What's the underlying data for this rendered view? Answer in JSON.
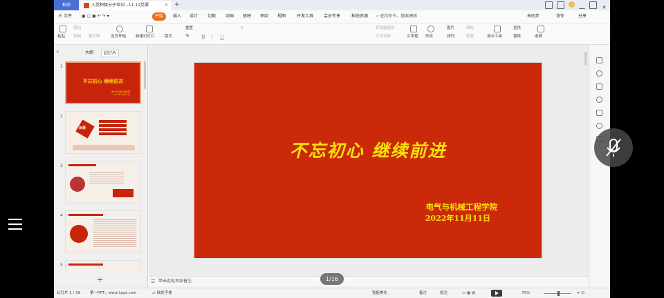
{
  "tabbar": {
    "home_label": "稻壳",
    "doc_title": "入党积极分子培训...11.11党课",
    "colors": {
      "home_bg": "#4a6fd2",
      "doc_icon": "#d24726"
    }
  },
  "menubar": {
    "file": "三 文件",
    "items": [
      "开始",
      "插入",
      "设计",
      "切换",
      "动画",
      "放映",
      "审阅",
      "视图",
      "开发工具",
      "会员专享",
      "稻壳资源"
    ],
    "active_index": 0,
    "search_placeholder": "查找命令、搜索模板",
    "right": [
      "未同步",
      "协作",
      "分享"
    ],
    "accent": "#f26b1d"
  },
  "ribbon": {
    "paste": "粘贴",
    "cut": "剪切",
    "copy": "复制",
    "format_painter": "格式刷",
    "play_from_current": "当页开始",
    "new_slide": "新建幻灯片",
    "layout": "版式",
    "reset": "重置",
    "section": "节",
    "bold": "B",
    "italic": "I",
    "underline": "U",
    "font_size": "0",
    "text_box": "文本框",
    "shape": "形状",
    "arrange": "排列",
    "picture": "图片",
    "fill": "填充",
    "outline": "轮廓",
    "find": "查找",
    "replace": "替换",
    "present_tools": "演示工具",
    "select": "选择",
    "convert_smartart": "转智能图形",
    "text_effects": "文字效果"
  },
  "leftpanel": {
    "outline_tab": "大纲",
    "slides_tab": "幻灯片",
    "slide_numbers": [
      "1",
      "2",
      "3",
      "4",
      "5"
    ],
    "thumb1_title": "不忘初心 继续前进",
    "thumb1_sub": [
      "电气与机械工程学院",
      "2022年11月11日"
    ],
    "thumb2_title": "目录",
    "add_label": "+"
  },
  "slide": {
    "title": "不忘初心 继续前进",
    "org": "电气与机械工程学院",
    "date": "2022年11月11日",
    "colors": {
      "bg": "#cb2a0a",
      "text": "#f9e207"
    }
  },
  "notes": {
    "placeholder": "单击此处添加备注"
  },
  "statusbar": {
    "slide_counter": "幻灯片 1 / 39",
    "theme": "第一PPT，www.1ppt.com",
    "missing_font": "缺失字体",
    "smart_beautify": "智能美化",
    "notes": "备注",
    "comments": "批注",
    "zoom": "75%"
  },
  "overlay": {
    "page_indicator": "1/16"
  }
}
